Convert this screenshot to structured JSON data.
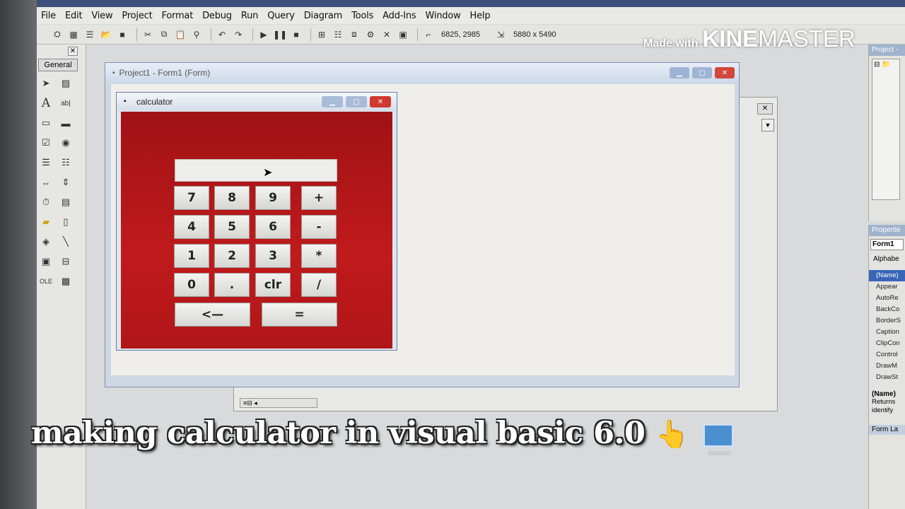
{
  "menubar": {
    "items": [
      "File",
      "Edit",
      "View",
      "Project",
      "Format",
      "Debug",
      "Run",
      "Query",
      "Diagram",
      "Tools",
      "Add-Ins",
      "Window",
      "Help"
    ]
  },
  "toolbar": {
    "position_readout": "6825, 2985",
    "size_readout": "5880 x 5490"
  },
  "toolbox": {
    "tab_label": "General",
    "close_label": "✕"
  },
  "designer": {
    "title": "Project1 - Form1 (Form)"
  },
  "calc_form": {
    "title": "calculator",
    "keys": [
      "7",
      "8",
      "9",
      "+",
      "4",
      "5",
      "6",
      "-",
      "1",
      "2",
      "3",
      "*",
      "0",
      ".",
      "clr",
      "/",
      "<—",
      "="
    ]
  },
  "properties": {
    "header": "Propertie",
    "object": "Form1",
    "tab": "Alphabe",
    "rows": [
      "(Name)",
      "Appear",
      "AutoRe",
      "BackCo",
      "BorderS",
      "Caption",
      "ClipCon",
      "Control",
      "DrawM",
      "DrawSt"
    ],
    "desc_title": "(Name)",
    "desc_text": "Returns identify",
    "form_layout": "Form La"
  },
  "project_panel": {
    "header": "Project -"
  },
  "watermark": {
    "made_with": "Made with",
    "brand_bold": "KINE",
    "brand_light": "MASTER"
  },
  "caption": {
    "text": "making calculator in visual basic 6.0",
    "emoji_hand": "👆"
  }
}
